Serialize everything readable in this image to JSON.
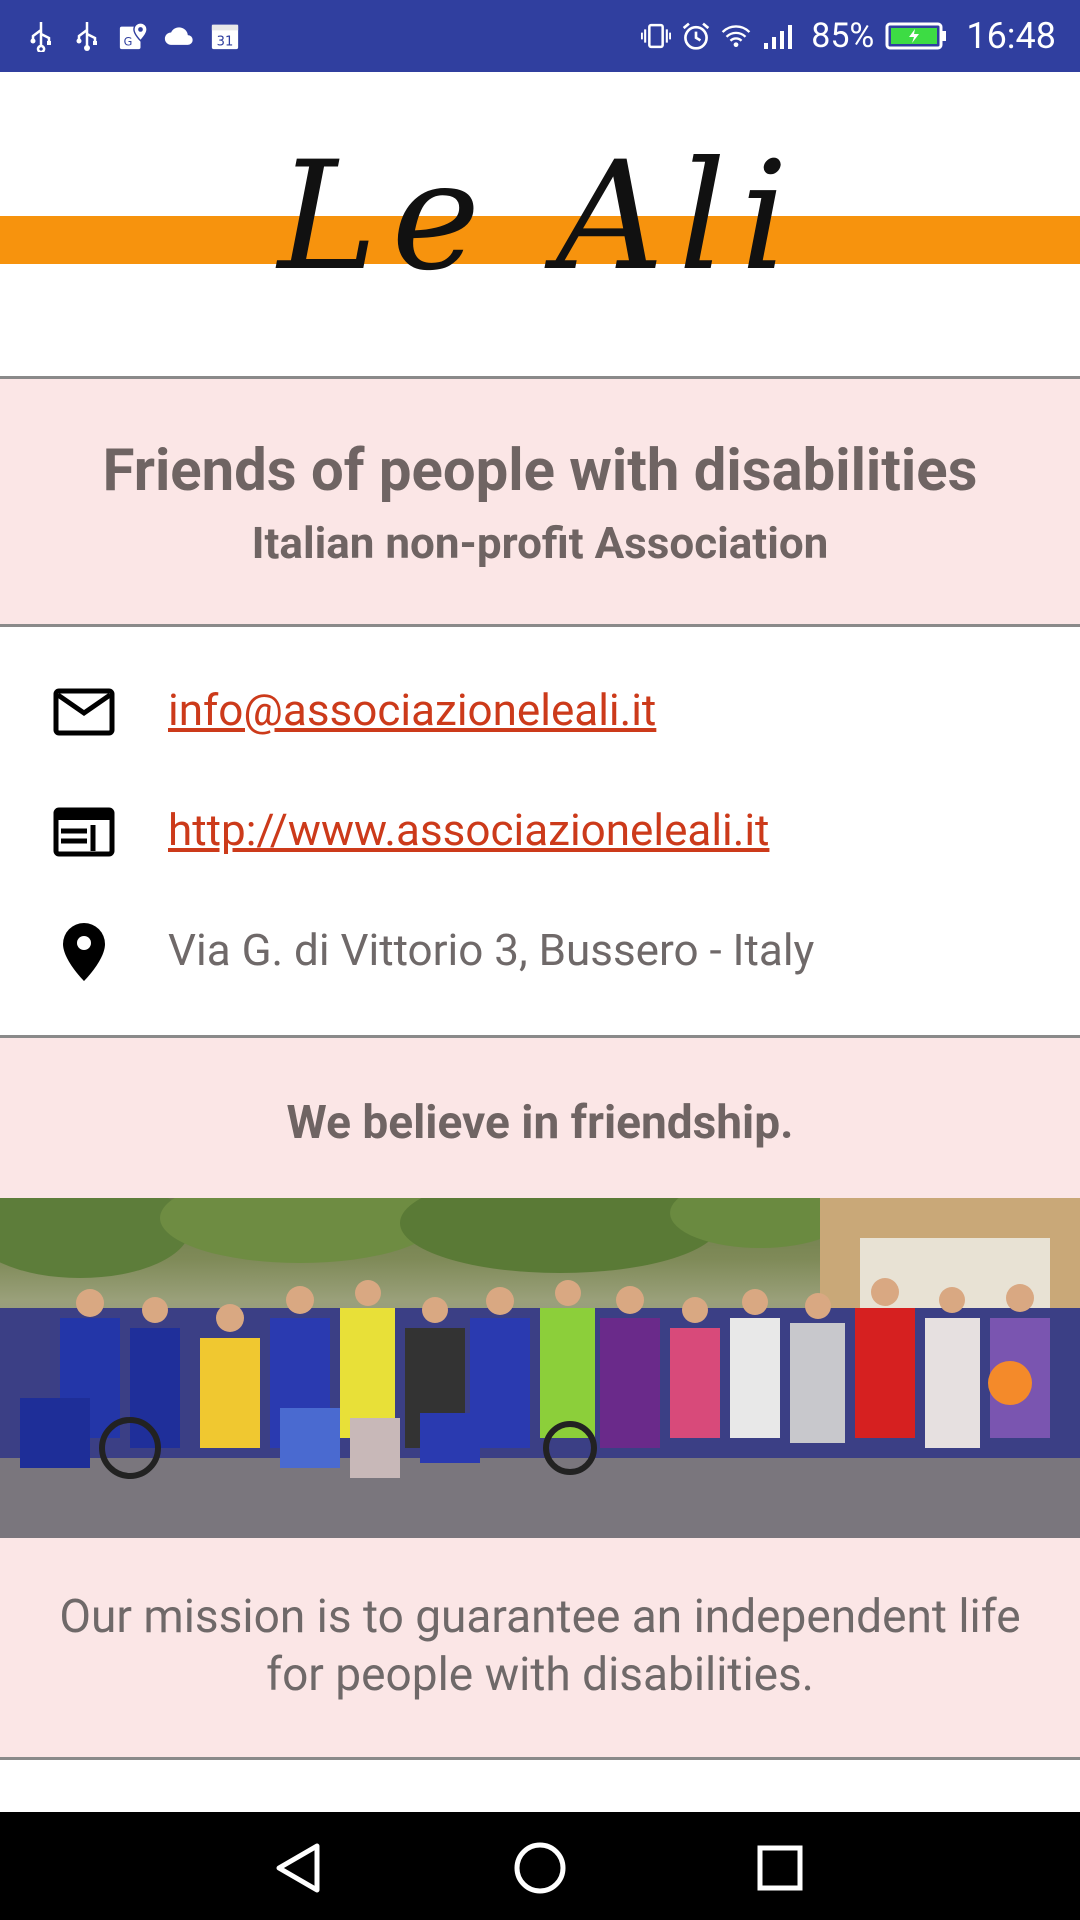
{
  "status_bar": {
    "left_icons": [
      "usb-icon",
      "usb-icon",
      "maps-icon",
      "cloud-icon",
      "calendar-icon"
    ],
    "calendar_day": "31",
    "right_icons": [
      "vibrate-icon",
      "alarm-icon",
      "wifi-icon",
      "signal-icon"
    ],
    "battery_percent": "85%",
    "time": "16:48",
    "battery_color": "#3ddc44"
  },
  "logo": {
    "text": "Le Ali",
    "stripe_color": "#f7930d"
  },
  "tagline": {
    "title": "Friends of people with disabilities",
    "subtitle": "Italian non-profit Association"
  },
  "contacts": {
    "email": "info@associazioneleali.it",
    "website": "http://www.associazioneleali.it",
    "address": "Via G. di Vittorio 3, Bussero - Italy",
    "link_color": "#cc3a1a"
  },
  "belief": {
    "title": "We believe in friendship."
  },
  "mission": {
    "text": "Our mission is to guarantee an independent life for people with disabilities."
  },
  "navigation": {
    "buttons": [
      "back",
      "home",
      "recents"
    ]
  }
}
